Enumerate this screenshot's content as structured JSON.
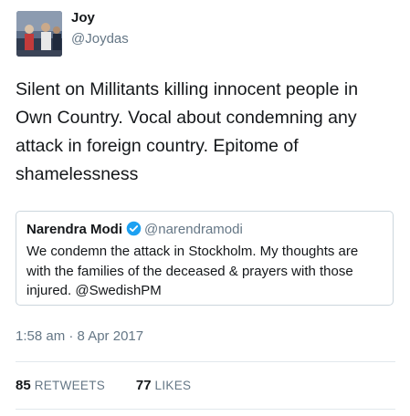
{
  "tweet": {
    "author": {
      "name": "Joy",
      "handle": "@Joydas"
    },
    "text": "Silent on Millitants killing innocent people in Own Country. Vocal about condemning any attack in foreign country. Epitome of shamelessness",
    "timestamp": "1:58 am · 8 Apr 2017"
  },
  "quoted_tweet": {
    "name": "Narendra Modi",
    "handle": "@narendramodi",
    "verified": true,
    "text": "We condemn the attack in Stockholm. My thoughts are with the families of the deceased & prayers with those injured. @SwedishPM"
  },
  "stats": {
    "retweets": {
      "count": "85",
      "label": "RETWEETS"
    },
    "likes": {
      "count": "77",
      "label": "LIKES"
    }
  },
  "colors": {
    "text_primary": "#14171a",
    "text_secondary": "#657786",
    "verified_badge": "#1da1f2",
    "border": "#ccd6dd",
    "divider": "#e1e8ed"
  },
  "icons": {
    "verified": "verified-badge-icon"
  }
}
